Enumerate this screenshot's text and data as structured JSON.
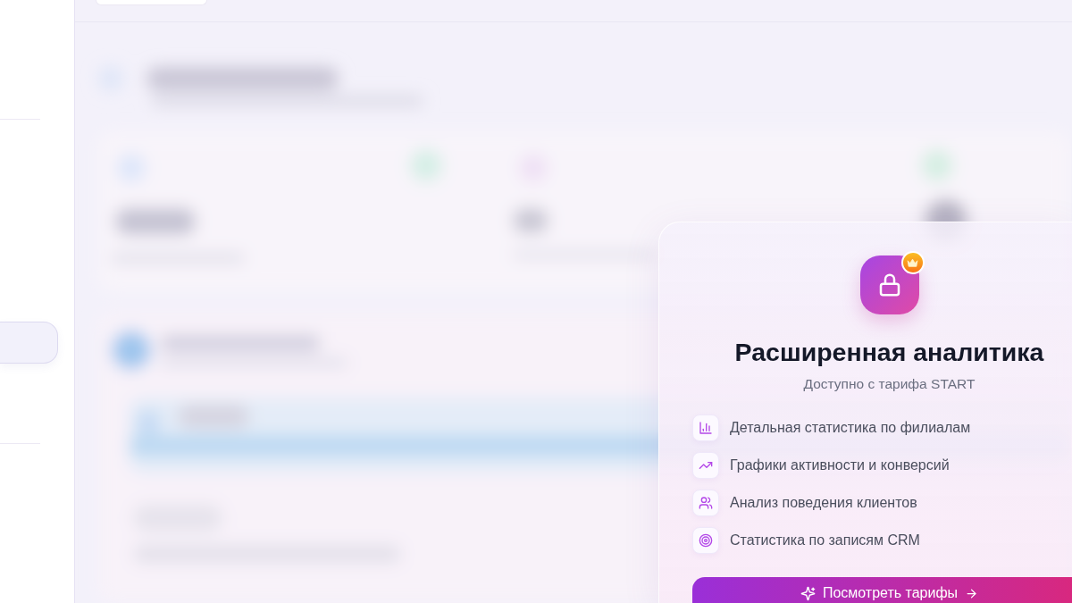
{
  "upgrade_overlay": {
    "title": "Расширенная аналитика",
    "subtitle": "Доступно с тарифа START",
    "features": [
      "Детальная статистика по филиалам",
      "Графики активности и конверсий",
      "Анализ поведения клиентов",
      "Статистика по записям CRM"
    ],
    "button": {
      "label": "Посмотреть тарифы"
    }
  }
}
